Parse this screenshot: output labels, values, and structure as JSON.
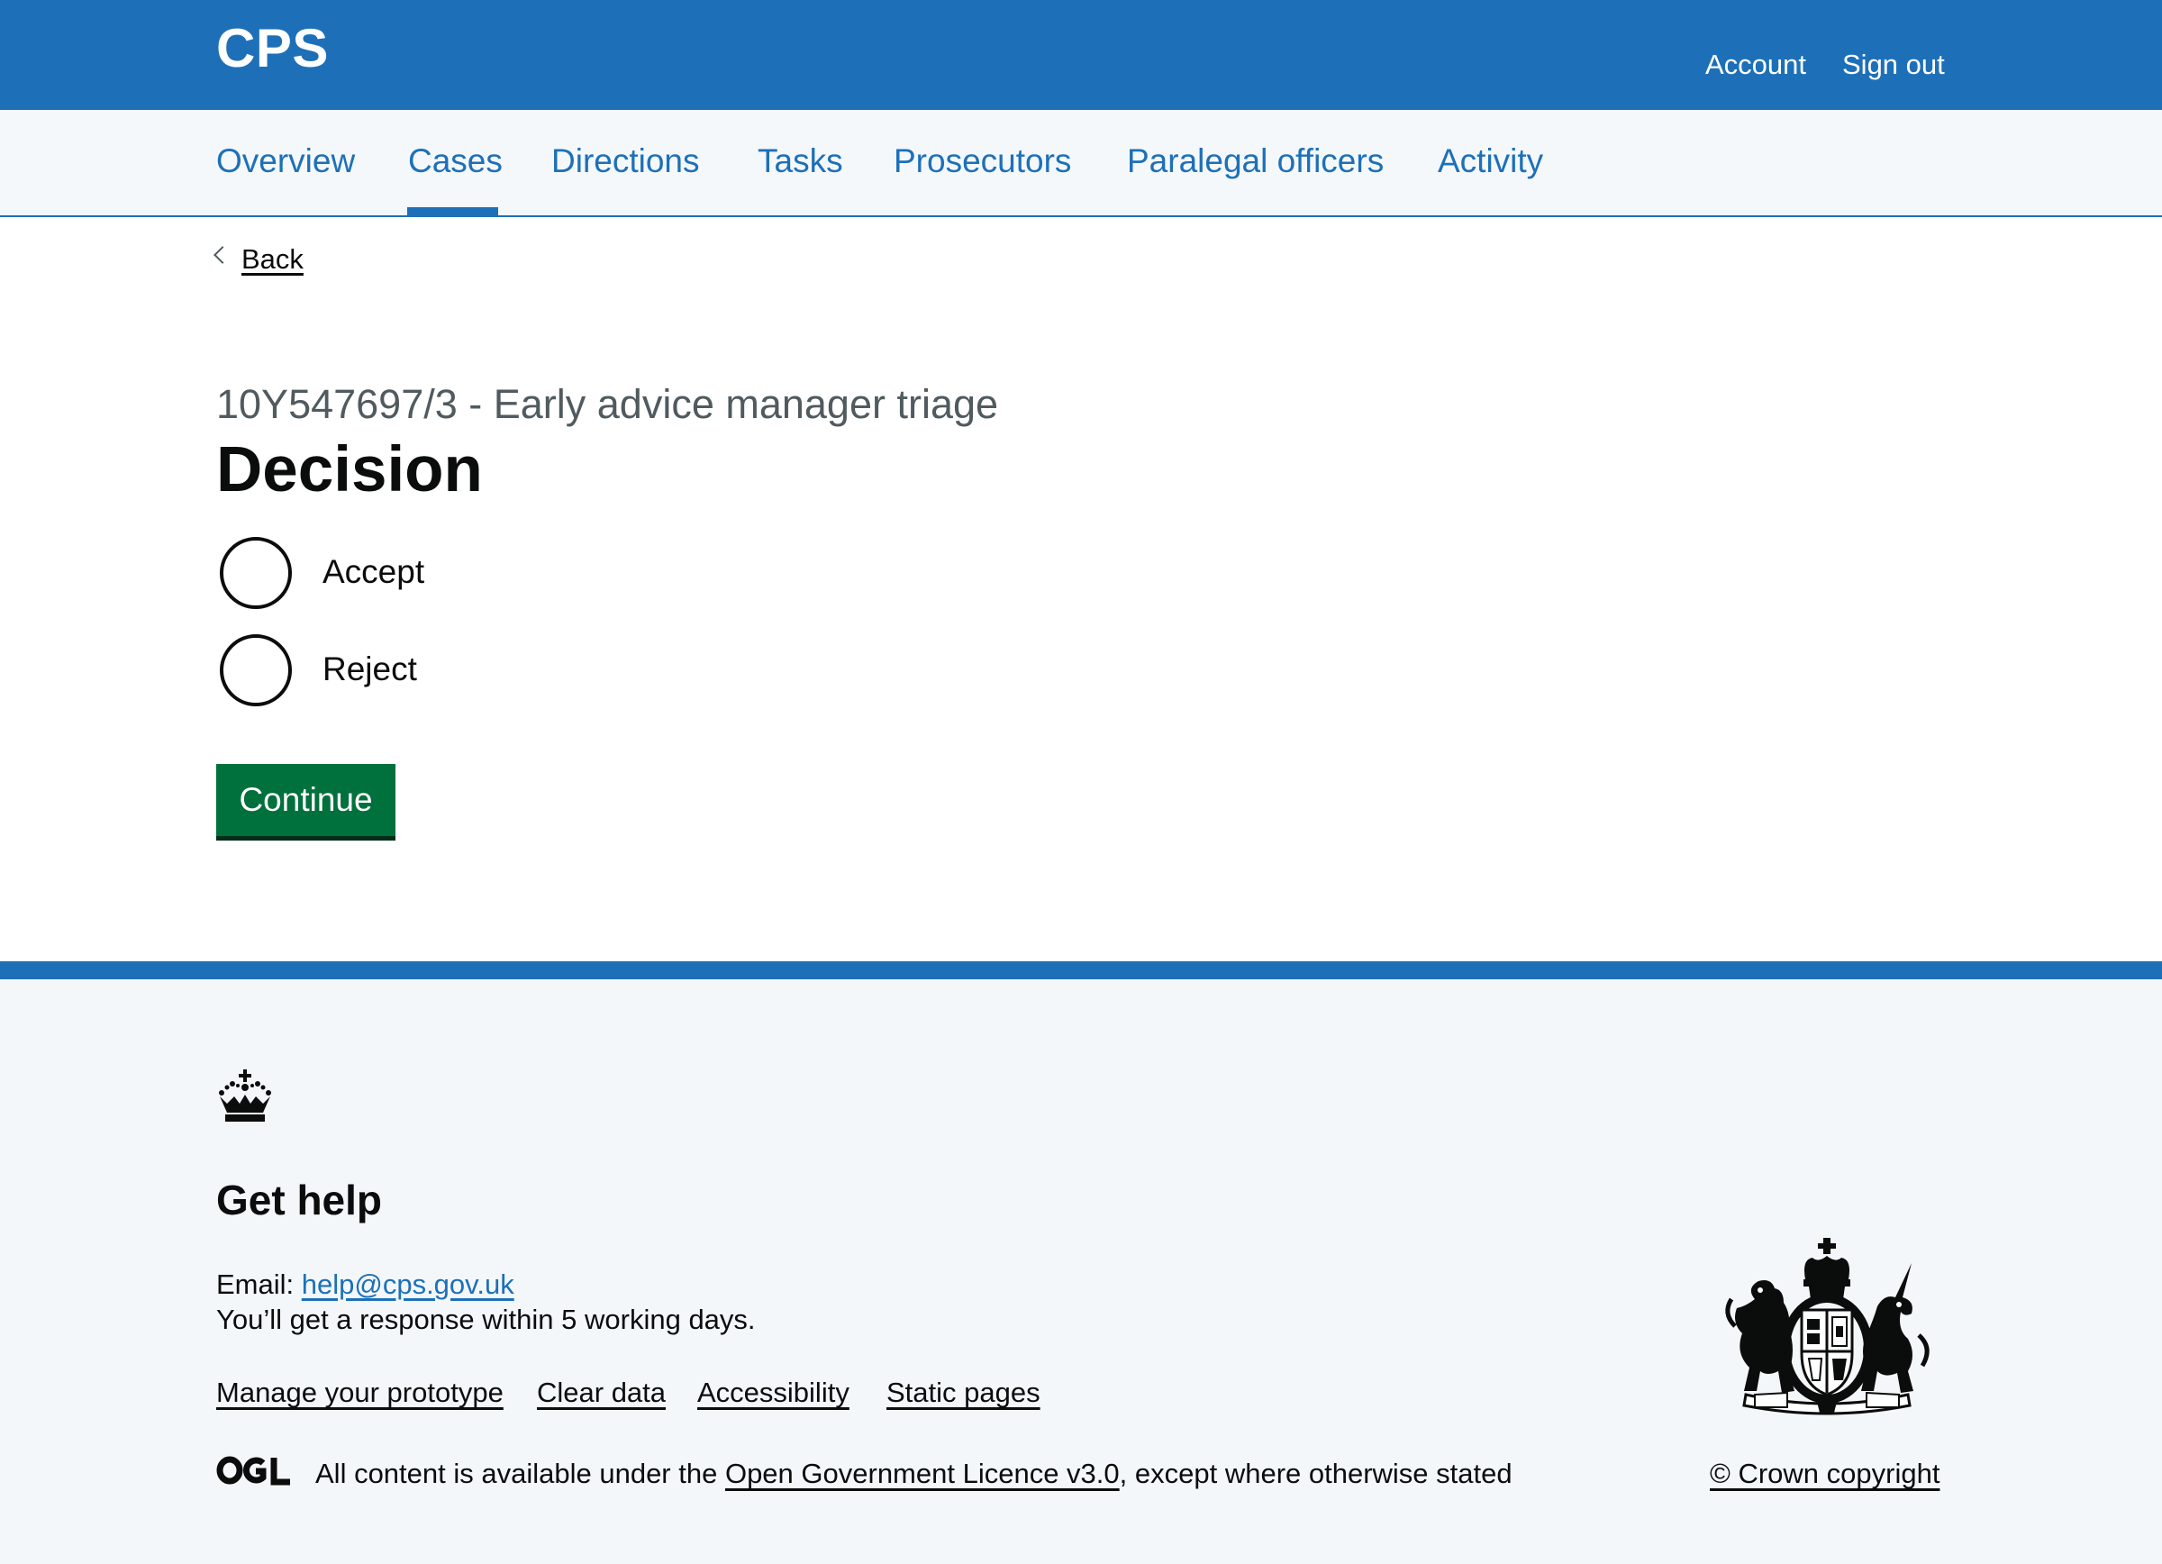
{
  "header": {
    "logo": "CPS",
    "links": {
      "account": "Account",
      "sign_out": "Sign out"
    }
  },
  "nav": {
    "items": [
      {
        "label": "Overview",
        "active": false
      },
      {
        "label": "Cases",
        "active": true
      },
      {
        "label": "Directions",
        "active": false
      },
      {
        "label": "Tasks",
        "active": false
      },
      {
        "label": "Prosecutors",
        "active": false
      },
      {
        "label": "Paralegal officers",
        "active": false
      },
      {
        "label": "Activity",
        "active": false
      }
    ]
  },
  "back": {
    "label": "Back"
  },
  "form": {
    "caption": "10Y547697/3 - Early advice manager triage",
    "heading": "Decision",
    "options": [
      {
        "label": "Accept",
        "selected": false
      },
      {
        "label": "Reject",
        "selected": false
      }
    ],
    "submit_label": "Continue"
  },
  "footer": {
    "help_title": "Get help",
    "email_prefix": "Email: ",
    "email": "help@cps.gov.uk",
    "response_text": "You’ll get a response within 5 working days.",
    "links": [
      "Manage your prototype",
      "Clear data",
      "Accessibility",
      "Static pages"
    ],
    "licence_prefix": "All content is available under the ",
    "licence_link": "Open Government Licence v3.0",
    "licence_suffix": ", except where otherwise stated",
    "copyright": "© Crown copyright",
    "ogl_logo": "OGL"
  },
  "colors": {
    "brand_blue": "#1d70b8",
    "button_green": "#00703c",
    "text": "#0b0c0c",
    "secondary_text": "#505a5f",
    "footer_background": "#f3f7fa"
  },
  "icons": {
    "back": "chevron-left-icon",
    "footer_crown": "crown-icon",
    "footer_arms": "royal-coat-of-arms-icon",
    "licence": "ogl-logo-icon"
  }
}
